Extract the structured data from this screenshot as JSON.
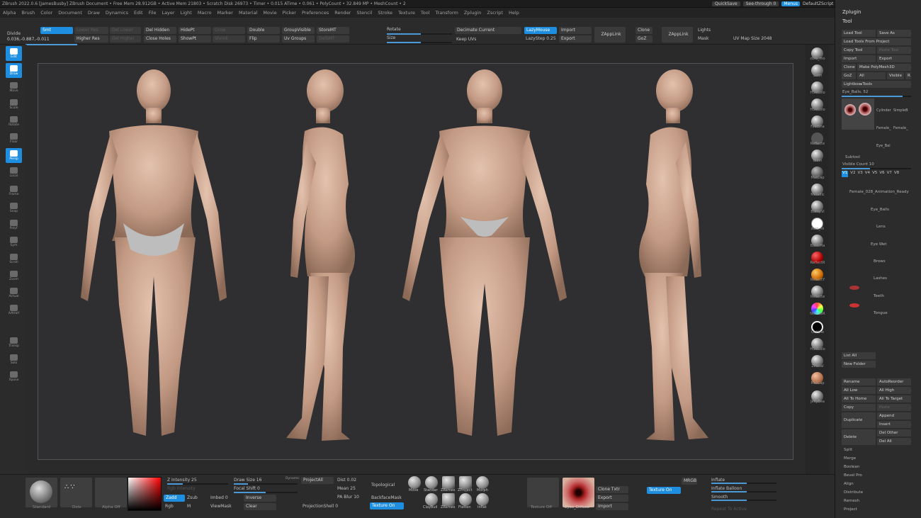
{
  "title_bar": {
    "text": "ZBrush 2022.0.6 [JamesBusby]   ZBrush Document     • Free Mem 28.912GB • Active Mem 21803 • Scratch Disk 26973 • Timer • 0.015 ATime • 0.061 • PolyCount • 32.849 MP • MeshCount • 2",
    "quicksave": "QuickSave",
    "see_through": "See-through  0",
    "menus": "Menus",
    "default_script": "DefaultZScript"
  },
  "menu_items": [
    "Alpha",
    "Brush",
    "Color",
    "Document",
    "Draw",
    "Dynamics",
    "Edit",
    "File",
    "Layer",
    "Light",
    "Macro",
    "Marker",
    "Material",
    "Movie",
    "Picker",
    "Preferences",
    "Render",
    "Stencil",
    "Stroke",
    "Texture",
    "Tool",
    "Transform",
    "Zplugin",
    "Zscript",
    "Help"
  ],
  "coords": "0.036,-0.887,-0.011",
  "top_shelf": {
    "divide": "Divide",
    "smt": "Smt",
    "lower_res": "Lower Res",
    "higher_res": "Higher Res",
    "del_lower": "Del Lower",
    "del_higher": "Del Higher",
    "del_hidden": "Del Hidden",
    "close_holes": "Close Holes",
    "hide_pt": "HidePt",
    "show_pt": "ShowPt",
    "grow": "Grow",
    "shrink": "Shrink",
    "double": "Double",
    "flip": "Flip",
    "group_visible": "GroupVisible",
    "uv_groups": "Uv Groups",
    "store_mt": "StoreMT",
    "del_smt": "DelSMT",
    "rotate": "Rotate",
    "size": "Size",
    "decimate_current": "Decimate Current",
    "keep_uvs": "Keep UVs",
    "lazy_mouse": "LazyMouse",
    "lazy_step": "LazyStep 0.25",
    "import": "Import",
    "export": "Export",
    "zapplink": "ZAppLink",
    "clone": "Clone",
    "goz": "GoZ",
    "lights": "Lights",
    "mask": "Mask",
    "uv_map_size": "UV Map Size 2048"
  },
  "left_tools": [
    "Edit",
    "Draw",
    "Move",
    "Scale",
    "Rotate",
    "Floor",
    "Persp",
    "Local",
    "Frame",
    "Snap",
    "PolyF",
    "Sym",
    "Scroll",
    "Zoom",
    "Actual",
    "AAHalf",
    "Transp",
    "Solo",
    "Xpose"
  ],
  "materials": [
    "zbro_mo",
    "Satin",
    "HSVColo",
    "HSVColo",
    "FastSha",
    "Reflecte",
    "Blinn",
    "MatCap",
    "Metallic",
    "BumpVi",
    "zbro_sk",
    "BasicMa",
    "ReflectR",
    "ReflectY",
    "Reflecte",
    "NormalR",
    "Outline",
    "HSVColo",
    "ZMetal",
    "MatCap",
    "JellyBea"
  ],
  "tool_panel": {
    "zplugin": "Zplugin",
    "tool": "Tool",
    "load_tool": "Load Tool",
    "save_as": "Save As",
    "load_tools_from_project": "Load Tools From Project",
    "copy_tool": "Copy Tool",
    "paste_tool": "Paste Tool",
    "import": "Import",
    "export": "Export",
    "clone": "Clone",
    "make_polymesh": "Make PolyMesh3D",
    "goz": "GoZ",
    "all": "All",
    "visible": "Visible",
    "r": "R",
    "lightbox_tools": "Lightbox▸Tools",
    "current_tool": "Eye_Balls. 52",
    "thumbs": [
      "Eye_Balls",
      "Cylinder",
      "SimpleB",
      "Female_",
      "Female_",
      "Eye_Bal"
    ],
    "subtool": "Subtool",
    "visible_count": "Visible Count 10",
    "versions": [
      "V1",
      "V2",
      "V3",
      "V4",
      "V5",
      "V6",
      "V7",
      "V8"
    ],
    "subtools": [
      "Female_028_Animation_Ready",
      "Eye_Balls",
      "Lens",
      "Eye Wet",
      "Brows",
      "Lashes",
      "Teeth",
      "Tongue"
    ],
    "list_all": "List All",
    "new_folder": "New Folder",
    "rename": "Rename",
    "autoreorder": "AutoReorder",
    "all_low": "All Low",
    "all_high": "All High",
    "all_to_home": "All To Home",
    "all_to_target": "All To Target",
    "copy": "Copy",
    "paste": "Paste",
    "duplicate": "Duplicate",
    "append": "Append",
    "insert": "Insert",
    "delete": "Delete",
    "del_other": "Del Other",
    "del_all": "Del All",
    "split": "Split",
    "merge": "Merge",
    "boolean": "Boolean",
    "bevel_pro": "Bevel Pro",
    "align": "Align",
    "distribute": "Distribute",
    "remesh": "Remesh",
    "project": "Project"
  },
  "bottom_shelf": {
    "standard": "Standard",
    "dots": "Dots",
    "alpha_off": "Alpha Off",
    "z_intensity": "Z Intensity 25",
    "rgb_intensity": "Rgb Intensity",
    "zadd": "Zadd",
    "zsub": "Zsub",
    "imbed": "Imbed 0",
    "rgb": "Rgb",
    "m": "M",
    "viewmask": "ViewMask",
    "draw_size": "Draw Size 16",
    "dynamic": "Dynamic",
    "focal_shift": "Focal Shift 0",
    "inverse": "Inverse",
    "clear": "Clear",
    "project_all": "ProjectAll",
    "dist": "Dist 0.02",
    "mean": "Mean 25",
    "pa_blur": "PA Blur 10",
    "projection_shell": "ProjectionShell 0",
    "topological": "Topological",
    "backface_mask": "BackfaceMask",
    "texture_on": "Texture On",
    "brushes": [
      "Move",
      "Standar",
      "ZRemes",
      "ZProject",
      "Morph",
      "ClayBuil",
      "ZRemes",
      "Flatten",
      "Inflat"
    ],
    "texture_off": "Texture Off",
    "eyes_diffuse": "Eyes_Diffuse",
    "clone_txtr": "Clone Txtr",
    "export": "Export",
    "import": "Import",
    "texture_on2": "Texture On",
    "mrgb": "MRGB",
    "inflate": "Inflate",
    "inflate_balloon": "Inflate Balloon",
    "smooth": "Smooth",
    "repeat_to_active": "Repeat To Active"
  },
  "colors": {
    "accent": "#1e8fe0",
    "viewport_bg": "#2f2f31",
    "skin": "#c9a08a"
  }
}
